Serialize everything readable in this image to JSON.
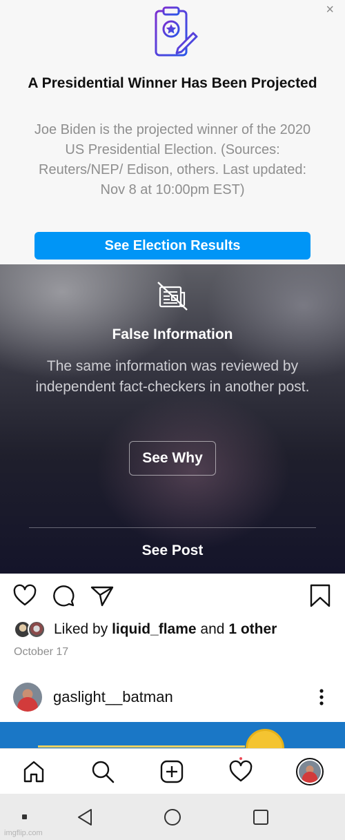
{
  "election_card": {
    "title": "A Presidential Winner Has Been Projected",
    "body": "Joe Biden is the projected winner of the 2020 US Presidential Election. (Sources: Reuters/NEP/ Edison, others. Last updated: Nov 8 at 10:00pm EST)",
    "button_label": "See Election Results",
    "close_glyph": "×",
    "icon": "ballot-clipboard-icon",
    "accent_color": "#0095f6",
    "icon_gradient": [
      "#6a2bd1",
      "#2a56e8"
    ]
  },
  "false_info": {
    "icon": "no-news-icon",
    "title": "False Information",
    "body": "The same information was reviewed by independent fact-checkers in another post.",
    "see_why_label": "See Why",
    "see_post_label": "See Post"
  },
  "actions": {
    "icons": [
      "heart-icon",
      "comment-icon",
      "share-icon",
      "bookmark-icon"
    ]
  },
  "likes": {
    "prefix": "Liked by ",
    "user": "liquid_flame",
    "middle": " and ",
    "others": "1 other"
  },
  "post_date": "October 17",
  "next_post": {
    "username": "gaslight__batman",
    "more_icon": "more-vertical-icon"
  },
  "bottom_nav": {
    "items": [
      "home-icon",
      "search-icon",
      "new-post-icon",
      "activity-icon",
      "profile-avatar"
    ],
    "activity_dot_color": "#ed4956"
  },
  "system_nav": [
    "back-icon",
    "home-circle-icon",
    "recents-icon"
  ],
  "watermark": "imgflip.com"
}
